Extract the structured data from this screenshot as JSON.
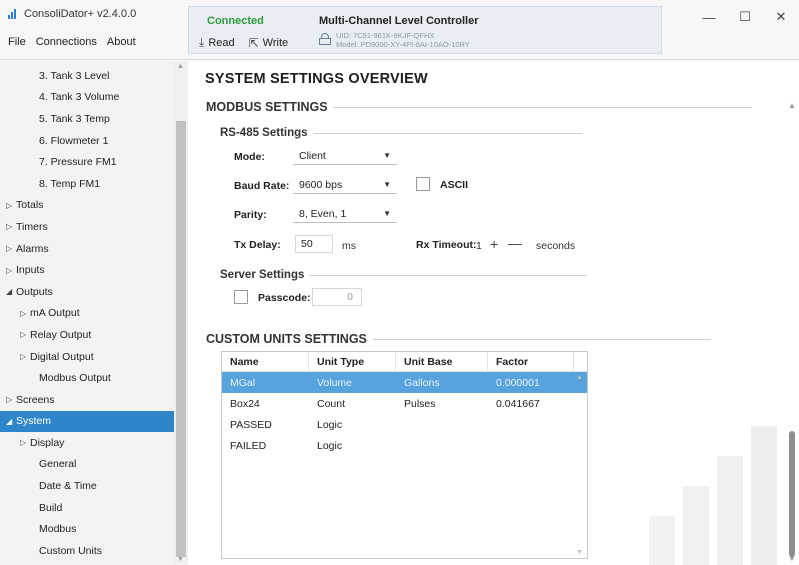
{
  "app": {
    "title": "ConsoliDator+ v2.4.0.0",
    "logo_icon": "bar-chart-logo-icon",
    "accent_color": "#2e85c9"
  },
  "menu": [
    "File",
    "Connections",
    "About"
  ],
  "connection": {
    "status": "Connected",
    "status_color": "#2e9a3a",
    "read_label": "Read",
    "write_label": "Write"
  },
  "device": {
    "name": "Multi-Channel Level Controller",
    "uid": "UID: 7C51-961K-9KJF-QFHX",
    "model": "Model: PD9000-XY-4PI-8AI-10AO-10RY"
  },
  "window_controls": {
    "minimize": "—",
    "maximize": "☐",
    "close": "✕"
  },
  "sidebar": {
    "items": [
      {
        "label": "3. Tank 3 Level",
        "level": 2,
        "tri": ""
      },
      {
        "label": "4. Tank 3 Volume",
        "level": 2,
        "tri": ""
      },
      {
        "label": "5. Tank 3 Temp",
        "level": 2,
        "tri": ""
      },
      {
        "label": "6. Flowmeter 1",
        "level": 2,
        "tri": ""
      },
      {
        "label": "7. Pressure FM1",
        "level": 2,
        "tri": ""
      },
      {
        "label": "8. Temp FM1",
        "level": 2,
        "tri": ""
      },
      {
        "label": "Totals",
        "level": 0,
        "tri": "▷"
      },
      {
        "label": "Timers",
        "level": 0,
        "tri": "▷"
      },
      {
        "label": "Alarms",
        "level": 0,
        "tri": "▷"
      },
      {
        "label": "Inputs",
        "level": 0,
        "tri": "▷"
      },
      {
        "label": "Outputs",
        "level": 0,
        "tri": "◢"
      },
      {
        "label": "mA Output",
        "level": 1,
        "tri": "▷"
      },
      {
        "label": "Relay Output",
        "level": 1,
        "tri": "▷"
      },
      {
        "label": "Digital Output",
        "level": 1,
        "tri": "▷"
      },
      {
        "label": "Modbus Output",
        "level": 2,
        "tri": ""
      },
      {
        "label": "Screens",
        "level": 0,
        "tri": "▷"
      },
      {
        "label": "System",
        "level": 0,
        "tri": "◢",
        "active": true
      },
      {
        "label": "Display",
        "level": 1,
        "tri": "▷"
      },
      {
        "label": "General",
        "level": 2,
        "tri": ""
      },
      {
        "label": "Date & Time",
        "level": 2,
        "tri": ""
      },
      {
        "label": "Build",
        "level": 2,
        "tri": ""
      },
      {
        "label": "Modbus",
        "level": 2,
        "tri": ""
      },
      {
        "label": "Custom Units",
        "level": 2,
        "tri": ""
      }
    ]
  },
  "main": {
    "title": "SYSTEM SETTINGS OVERVIEW",
    "modbus": {
      "heading": "MODBUS SETTINGS",
      "rs485": {
        "heading": "RS-485 Settings",
        "mode_label": "Mode:",
        "mode_value": "Client",
        "baud_label": "Baud Rate:",
        "baud_value": "9600 bps",
        "ascii_label": "ASCII",
        "ascii_checked": false,
        "parity_label": "Parity:",
        "parity_value": "8, Even, 1",
        "txdelay_label": "Tx Delay:",
        "txdelay_value": "50",
        "txdelay_unit": "ms",
        "rxtimeout_label": "Rx Timeout:",
        "rxtimeout_value": "1",
        "rxtimeout_unit": "seconds",
        "plus": "+",
        "minus": "—"
      },
      "server": {
        "heading": "Server Settings",
        "passcode_label": "Passcode:",
        "passcode_value": "0",
        "passcode_checked": false
      }
    },
    "custom_units": {
      "heading": "CUSTOM UNITS SETTINGS",
      "columns": [
        "Name",
        "Unit Type",
        "Unit Base",
        "Factor"
      ],
      "rows": [
        [
          "MGal",
          "Volume",
          "Gallons",
          "0.000001"
        ],
        [
          "Box24",
          "Count",
          "Pulses",
          "0.041667"
        ],
        [
          "PASSED",
          "Logic",
          "",
          ""
        ],
        [
          "FAILED",
          "Logic",
          "",
          ""
        ]
      ],
      "selected_row": 0,
      "selected_color": "#56a3de"
    }
  }
}
